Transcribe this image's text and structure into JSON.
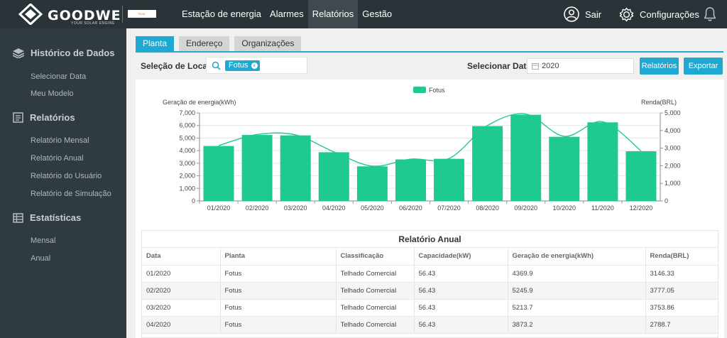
{
  "header": {
    "brand": "GOODWE",
    "brand_sub": "YOUR SOLAR ENGINE",
    "flag_text": "TEXA",
    "nav": [
      {
        "label": "Estação de energia",
        "active": false
      },
      {
        "label": "Alarmes",
        "active": false
      },
      {
        "label": "Relatórios",
        "active": true
      },
      {
        "label": "Gestão",
        "active": false
      }
    ],
    "logout": "Sair",
    "settings": "Configurações"
  },
  "sidebar": {
    "sections": [
      {
        "label": "Histórico de Dados",
        "icon": "layers-icon",
        "items": [
          "Selecionar Data",
          "Meu Modelo"
        ]
      },
      {
        "label": "Relatórios",
        "icon": "document-icon",
        "items": [
          "Relatório Mensal",
          "Relatório Anual",
          "Relatório do Usuário",
          "Relatório de Simulação"
        ]
      },
      {
        "label": "Estatísticas",
        "icon": "table-icon",
        "items": [
          "Mensal",
          "Anual"
        ]
      }
    ]
  },
  "tabs": [
    "Planta",
    "Endereço",
    "Organizações"
  ],
  "filters": {
    "locations_label": "Seleção de Locais",
    "location_chip": "Fotus",
    "date_label": "Selecionar Data",
    "date_value": "2020",
    "reports_button": "Relatórios",
    "export_button": "Exportar"
  },
  "colors": {
    "accent": "#1fa9d2",
    "bar": "#1ec992",
    "dark": "#2a3338",
    "sidebar": "#2f3b40"
  },
  "chart_data": {
    "type": "bar",
    "legend": [
      "Fotus"
    ],
    "categories": [
      "01/2020",
      "02/2020",
      "03/2020",
      "04/2020",
      "05/2020",
      "06/2020",
      "07/2020",
      "08/2020",
      "09/2020",
      "10/2020",
      "11/2020",
      "12/2020"
    ],
    "series": [
      {
        "name": "Fotus",
        "type": "bar",
        "axis": "left",
        "values": [
          4369.9,
          5245.9,
          5213.7,
          3873.2,
          2750,
          3300,
          3350,
          5950,
          6850,
          5100,
          6250,
          3950
        ]
      },
      {
        "name": "Renda(BRL)",
        "type": "line",
        "axis": "right",
        "values": [
          3146.33,
          3777.05,
          3753.86,
          2788.7,
          1980,
          2376,
          2412,
          4284,
          4932,
          3672,
          4500,
          2844
        ]
      }
    ],
    "ylabel": "Geração de energia(kWh)",
    "ylabel_right": "Renda(BRL)",
    "ylim": [
      0,
      7000
    ],
    "yticks": [
      "0",
      "1,000",
      "2,000",
      "3,000",
      "4,000",
      "5,000",
      "6,000",
      "7,000"
    ],
    "ylim_right": [
      0,
      5000
    ],
    "yticks_right": [
      "0",
      "1,000",
      "2,000",
      "3,000",
      "4,000",
      "5,000"
    ],
    "grid": true,
    "legend_position": "top-center"
  },
  "table": {
    "title": "Relatório Anual",
    "columns": [
      "Data",
      "Planta",
      "Classificação",
      "Capacidade(kW)",
      "Geração de energia(kWh)",
      "Renda(BRL)"
    ],
    "rows": [
      [
        "01/2020",
        "Fotus",
        "Telhado Comercial",
        "56.43",
        "4369.9",
        "3146.33"
      ],
      [
        "02/2020",
        "Fotus",
        "Telhado Comercial",
        "56.43",
        "5245.9",
        "3777.05"
      ],
      [
        "03/2020",
        "Fotus",
        "Telhado Comercial",
        "56.43",
        "5213.7",
        "3753.86"
      ],
      [
        "04/2020",
        "Fotus",
        "Telhado Comercial",
        "56.43",
        "3873.2",
        "2788.7"
      ]
    ]
  }
}
